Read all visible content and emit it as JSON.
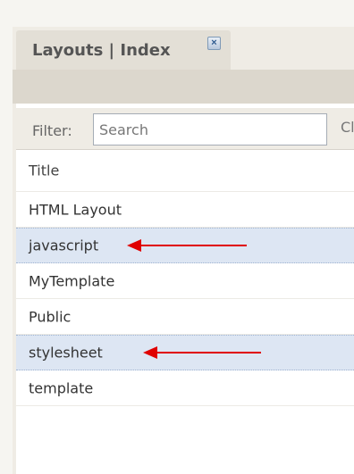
{
  "tab": {
    "title": "Layouts | Index",
    "close_icon": "close-icon"
  },
  "filter": {
    "label": "Filter:",
    "placeholder": "Search",
    "value": "",
    "clipped_button_text": "Cl"
  },
  "table": {
    "header": "Title",
    "rows": [
      {
        "title": "HTML Layout",
        "selected": false
      },
      {
        "title": "javascript",
        "selected": true
      },
      {
        "title": "MyTemplate",
        "selected": false
      },
      {
        "title": "Public",
        "selected": false
      },
      {
        "title": "stylesheet",
        "selected": true
      },
      {
        "title": "template",
        "selected": false
      }
    ]
  },
  "colors": {
    "selected_row": "#dde6f3",
    "arrow": "#e00000",
    "tab_bg": "#e3dfd6"
  }
}
